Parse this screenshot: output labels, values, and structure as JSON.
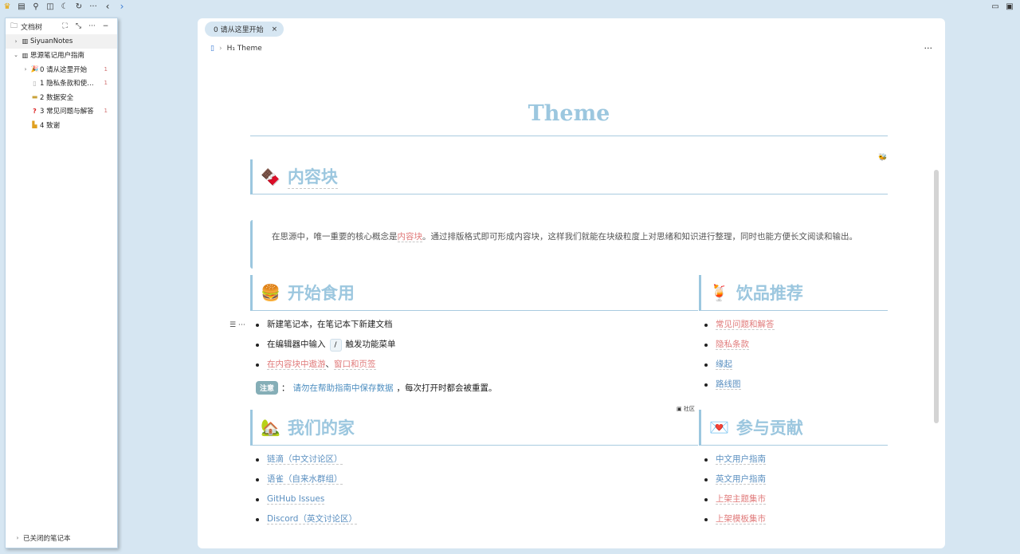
{
  "toolbar": {
    "left_icons": [
      "crown-icon",
      "calendar-icon",
      "search-icon",
      "layout-icon",
      "moon-icon",
      "sync-icon",
      "more-icon",
      "back-icon",
      "forward-icon"
    ],
    "right_icons": [
      "minimize-icon",
      "maximize-icon"
    ]
  },
  "sidebar": {
    "title": "文档树",
    "notebooks": [
      {
        "name": "SiyuanNotes"
      },
      {
        "name": "思源笔记用户指南"
      }
    ],
    "docs": [
      {
        "label": "0 请从这里开始",
        "count": "1"
      },
      {
        "label": "1 隐私条款和使…",
        "count": "1"
      },
      {
        "label": "2 数据安全",
        "count": ""
      },
      {
        "label": "3 常见问题与解答",
        "count": "1"
      },
      {
        "label": "4 致谢",
        "count": ""
      }
    ],
    "footer": "已关闭的笔记本"
  },
  "editor": {
    "tab_label": "0 请从这里开始",
    "tab_close": "×",
    "breadcrumb_heading": "H₁ Theme",
    "more": "···",
    "title": "Theme",
    "section_content_block": "内容块",
    "quote_pre": "在思源中，唯一重要的核心概念是",
    "quote_link": "内容块",
    "quote_post": "。通过排版格式即可形成内容块，这样我们就能在块级粒度上对思绪和知识进行整理，同时也能方便长文阅读和输出。",
    "section_start": "开始食用",
    "start_items": {
      "item1": "新建笔记本，在笔记本下新建文档",
      "item2_pre": "在编辑器中输入",
      "item2_kbd": "/",
      "item2_post": "触发功能菜单",
      "item3_link1": "在内容块中遨游",
      "item3_sep": "、",
      "item3_link2": "窗口和页签"
    },
    "note_badge": "注意",
    "note_colon": "：",
    "note_link": "请勿在帮助指南中保存数据",
    "note_post": "，每次打开时都会被重置。",
    "community": "▣ 社区",
    "section_drinks": "饮品推荐",
    "drink_items": [
      {
        "label": "常见问题和解答",
        "color": "red"
      },
      {
        "label": "隐私条款",
        "color": "red"
      },
      {
        "label": "缘起",
        "color": "blue"
      },
      {
        "label": "路线图",
        "color": "blue"
      }
    ],
    "section_home": "我们的家",
    "home_items": [
      "链滴（中文讨论区）",
      "语雀（自来水群组）",
      "GitHub Issues",
      "Discord（英文讨论区）"
    ],
    "section_contribute": "参与贡献",
    "contribute_items": [
      {
        "label": "中文用户指南",
        "color": "blue"
      },
      {
        "label": "英文用户指南",
        "color": "blue"
      },
      {
        "label": "上架主题集市",
        "color": "red"
      },
      {
        "label": "上架模板集市",
        "color": "red"
      }
    ]
  },
  "colors": {
    "accent": "#9cc7df",
    "link_red": "#e07a7a",
    "link_blue": "#5a8fc0",
    "background": "#d6e6f2"
  }
}
